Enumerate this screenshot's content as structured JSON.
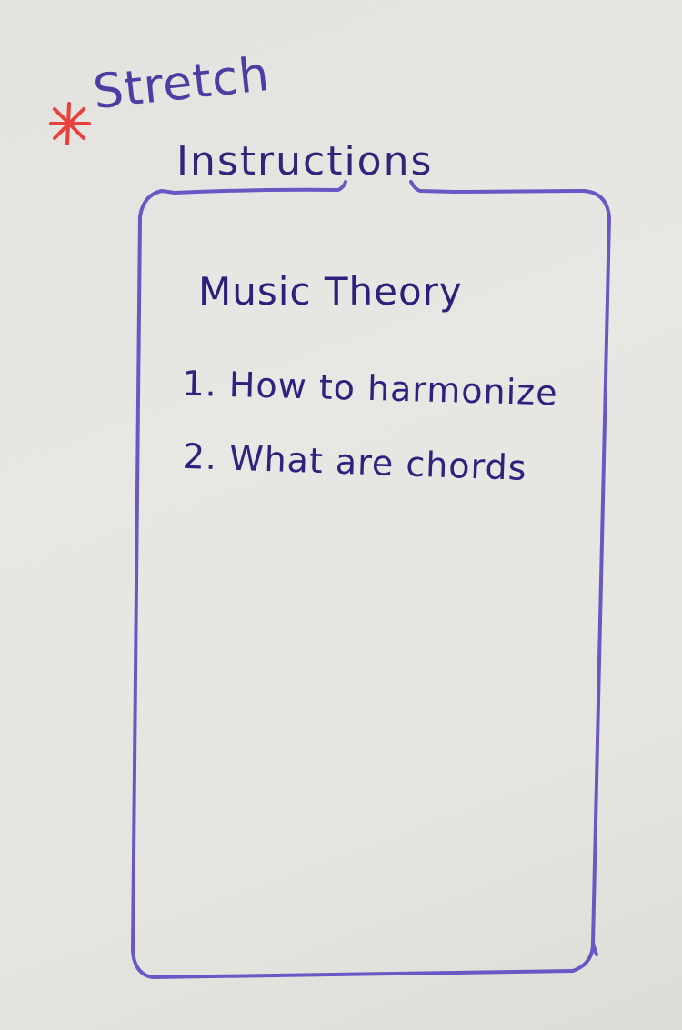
{
  "annotation": {
    "marker_label": "Stretch",
    "marker_color": "#e8403a",
    "ink_color": "#4a3ea2"
  },
  "screen": {
    "heading": "Instructions",
    "frame_color": "#6a56c4"
  },
  "content": {
    "title": "Music Theory",
    "items": [
      {
        "text": "1. How to harmonize"
      },
      {
        "text": "2. What are chords"
      }
    ]
  }
}
